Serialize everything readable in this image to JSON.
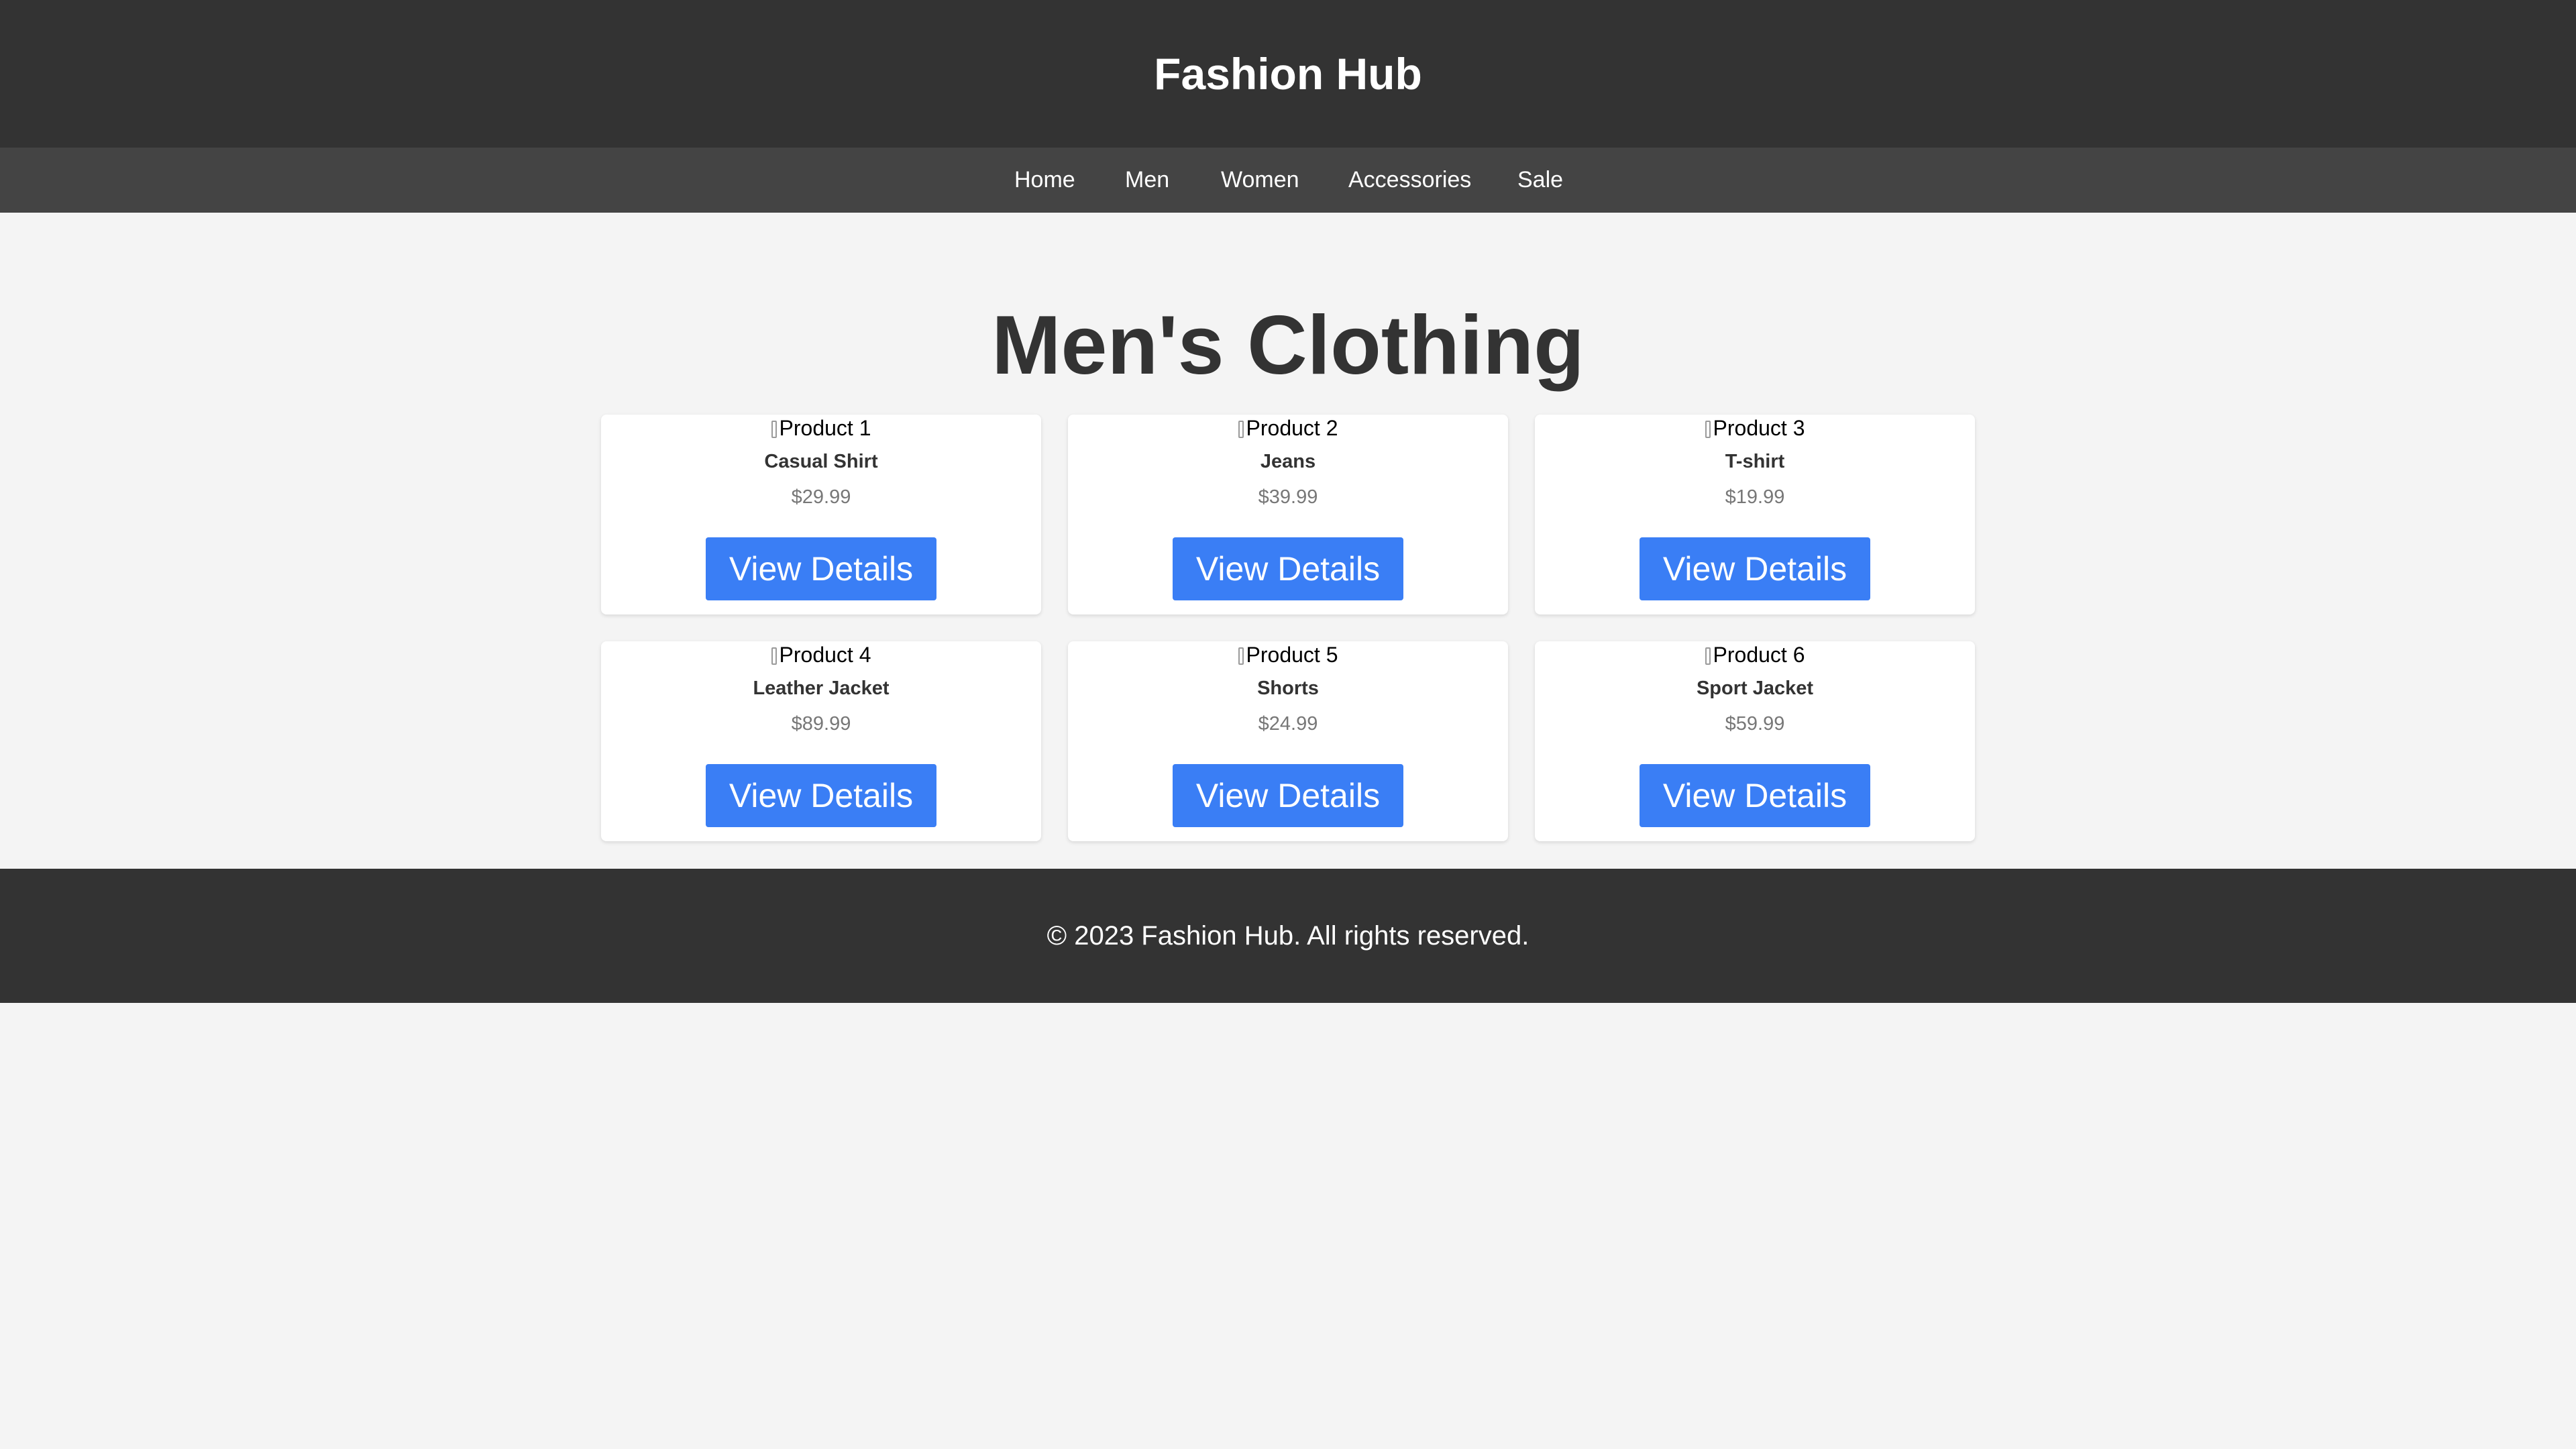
{
  "header": {
    "title": "Fashion Hub"
  },
  "nav": {
    "items": [
      {
        "label": "Home"
      },
      {
        "label": "Men"
      },
      {
        "label": "Women"
      },
      {
        "label": "Accessories"
      },
      {
        "label": "Sale"
      }
    ]
  },
  "main": {
    "heading": "Men's Clothing",
    "products": [
      {
        "image_alt": "Product 1",
        "name": "Casual Shirt",
        "price": "$29.99",
        "button_label": "View Details"
      },
      {
        "image_alt": "Product 2",
        "name": "Jeans",
        "price": "$39.99",
        "button_label": "View Details"
      },
      {
        "image_alt": "Product 3",
        "name": "T-shirt",
        "price": "$19.99",
        "button_label": "View Details"
      },
      {
        "image_alt": "Product 4",
        "name": "Leather Jacket",
        "price": "$89.99",
        "button_label": "View Details"
      },
      {
        "image_alt": "Product 5",
        "name": "Shorts",
        "price": "$24.99",
        "button_label": "View Details"
      },
      {
        "image_alt": "Product 6",
        "name": "Sport Jacket",
        "price": "$59.99",
        "button_label": "View Details"
      }
    ]
  },
  "footer": {
    "text": "© 2023 Fashion Hub. All rights reserved."
  },
  "colors": {
    "header_bg": "#333333",
    "nav_bg": "#444444",
    "page_bg": "#f4f4f4",
    "button_bg": "#3a7ef5"
  }
}
